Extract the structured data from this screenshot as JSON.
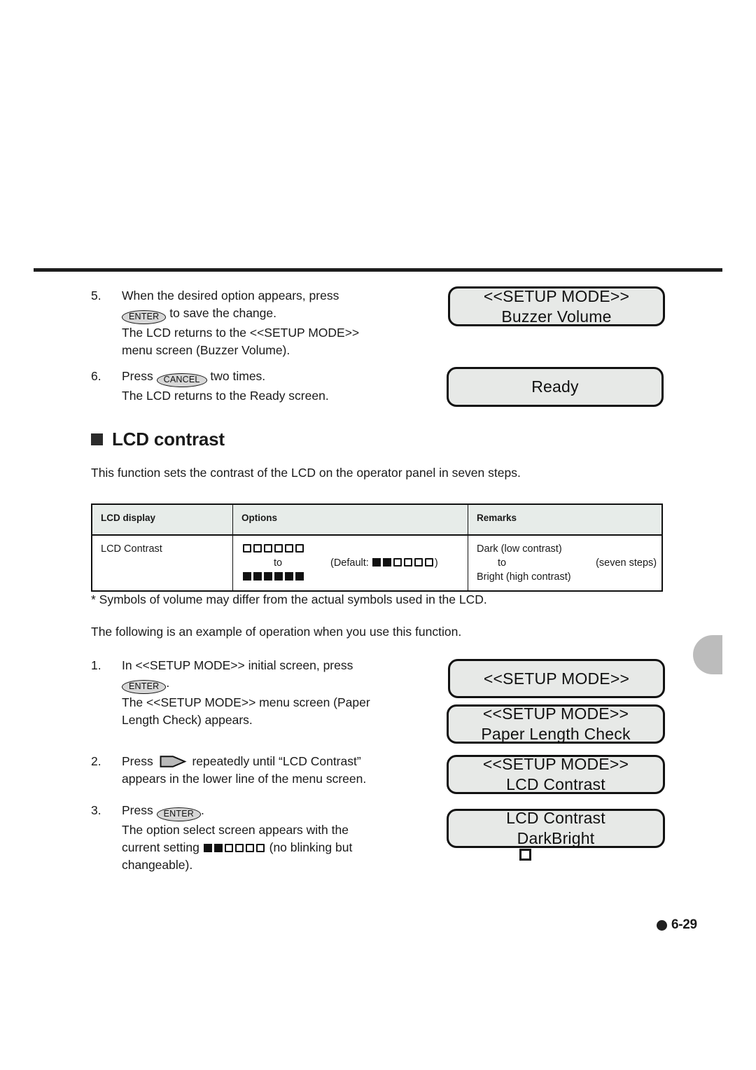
{
  "page": {
    "number_label": "6-29"
  },
  "steps_top": [
    {
      "num": "5.",
      "lines": [
        "When the desired option appears, press",
        "__KEY_ENTER__ to save the change.",
        "The LCD returns to the <<SETUP MODE>>",
        "menu screen (Buzzer Volume)."
      ],
      "line1": "When the desired option appears, press",
      "key_label": "ENTER",
      "line2_after": " to save the change.",
      "line3": "The LCD returns to the <<SETUP MODE>>",
      "line4": "menu screen (Buzzer Volume)."
    },
    {
      "num": "6.",
      "line1_before": "Press ",
      "key_label": "CANCEL",
      "line1_after": " two times.",
      "line2": "The LCD returns to the Ready screen."
    }
  ],
  "section": {
    "bullet_icon": "filled-square-bullet",
    "title": "LCD contrast",
    "intro": "This function sets the contrast of the LCD on the operator panel in seven steps."
  },
  "table": {
    "headers": [
      "LCD display",
      "Options",
      "Remarks"
    ],
    "row": {
      "lcd_display": "LCD Contrast",
      "options": {
        "top_squares": [
          "empty",
          "empty",
          "empty",
          "empty",
          "empty",
          "empty"
        ],
        "to_label": "to",
        "bottom_squares": [
          "filled",
          "filled",
          "filled",
          "filled",
          "filled",
          "filled"
        ],
        "default_prefix": "(Default: ",
        "default_squares": [
          "filled",
          "filled",
          "empty",
          "empty",
          "empty",
          "empty"
        ],
        "default_suffix": ")"
      },
      "remarks": {
        "line1": "Dark (low contrast)",
        "to_label": "to",
        "steps_label": "(seven steps)",
        "line3": "Bright (high contrast)"
      }
    }
  },
  "footnote": "* Symbols of volume may differ from the actual symbols used in the LCD.",
  "followup": "The following is an example of operation when you use this function.",
  "steps_bottom": [
    {
      "num": "1.",
      "line1": "In <<SETUP MODE>> initial screen, press",
      "key_label": "ENTER",
      "key_suffix": ".",
      "line3": "The <<SETUP MODE>> menu screen (Paper",
      "line4": "Length Check) appears."
    },
    {
      "num": "2.",
      "line1_before": "Press ",
      "arrow_icon": "right-arrow-key-icon",
      "line1_after": " repeatedly until “LCD Contrast”",
      "line2": "appears in the lower line of the menu screen."
    },
    {
      "num": "3.",
      "line1_before": "Press ",
      "key_label": "ENTER",
      "line1_after": ".",
      "line2": "The option select screen appears with the",
      "line3_before": "current setting ",
      "setting_squares": [
        "filled",
        "filled",
        "empty",
        "empty",
        "empty",
        "empty"
      ],
      "line3_after": " (no blinking but",
      "line4": "changeable)."
    }
  ],
  "lcd_panels": {
    "buzzer_volume": {
      "line1": "<<SETUP MODE>>",
      "line2": "Buzzer Volume"
    },
    "ready": {
      "line1": "Ready",
      "line2": ""
    },
    "setup_mode": {
      "line1": "<<SETUP MODE>>",
      "line2": ""
    },
    "paper_length_check": {
      "line1": "<<SETUP MODE>>",
      "line2": "Paper Length Check"
    },
    "lcd_contrast_menu": {
      "line1": "<<SETUP MODE>>",
      "line2": "LCD Contrast"
    },
    "lcd_contrast_option": {
      "line1": "LCD Contrast",
      "dark_label": "Dark",
      "squares": [
        "filled",
        "filled",
        "empty",
        "empty",
        "empty",
        "empty"
      ],
      "bright_label": "Bright"
    }
  }
}
